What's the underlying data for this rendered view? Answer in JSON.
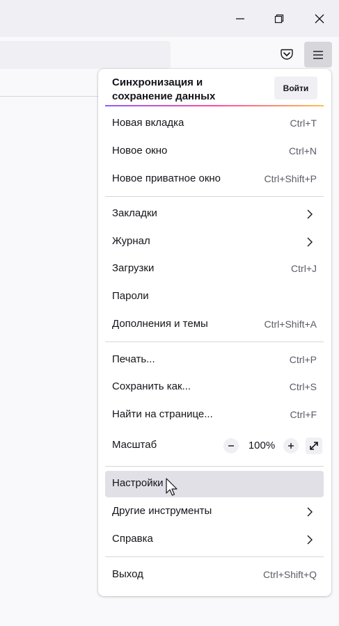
{
  "window": {
    "controls": {
      "minimize_icon": "minimize-icon",
      "restore_icon": "restore-icon",
      "close_icon": "close-icon"
    }
  },
  "toolbar": {
    "pocket_icon": "pocket-icon",
    "menu_icon": "hamburger-icon"
  },
  "colors": {
    "accent_gradient": [
      "#9059ff",
      "#ff4aa2",
      "#ffbd4f"
    ],
    "hover": "#e0e0e6",
    "panel": "#ffffff"
  },
  "menu": {
    "sync": {
      "title": "Синхронизация и сохранение данных",
      "signin_label": "Войти"
    },
    "items": [
      {
        "label": "Новая вкладка",
        "shortcut": "Ctrl+T"
      },
      {
        "label": "Новое окно",
        "shortcut": "Ctrl+N"
      },
      {
        "label": "Новое приватное окно",
        "shortcut": "Ctrl+Shift+P"
      },
      {
        "label": "Закладки",
        "submenu": true
      },
      {
        "label": "Журнал",
        "submenu": true
      },
      {
        "label": "Загрузки",
        "shortcut": "Ctrl+J"
      },
      {
        "label": "Пароли"
      },
      {
        "label": "Дополнения и темы",
        "shortcut": "Ctrl+Shift+A"
      },
      {
        "label": "Печать...",
        "shortcut": "Ctrl+P"
      },
      {
        "label": "Сохранить как...",
        "shortcut": "Ctrl+S"
      },
      {
        "label": "Найти на странице...",
        "shortcut": "Ctrl+F"
      },
      {
        "label": "Масштаб"
      },
      {
        "label": "Настройки",
        "highlighted": true
      },
      {
        "label": "Другие инструменты",
        "submenu": true
      },
      {
        "label": "Справка",
        "submenu": true
      },
      {
        "label": "Выход",
        "shortcut": "Ctrl+Shift+Q"
      }
    ],
    "zoom": {
      "value": "100%",
      "minus_icon": "minus-icon",
      "plus_icon": "plus-icon",
      "fullscreen_icon": "fullscreen-icon"
    }
  }
}
